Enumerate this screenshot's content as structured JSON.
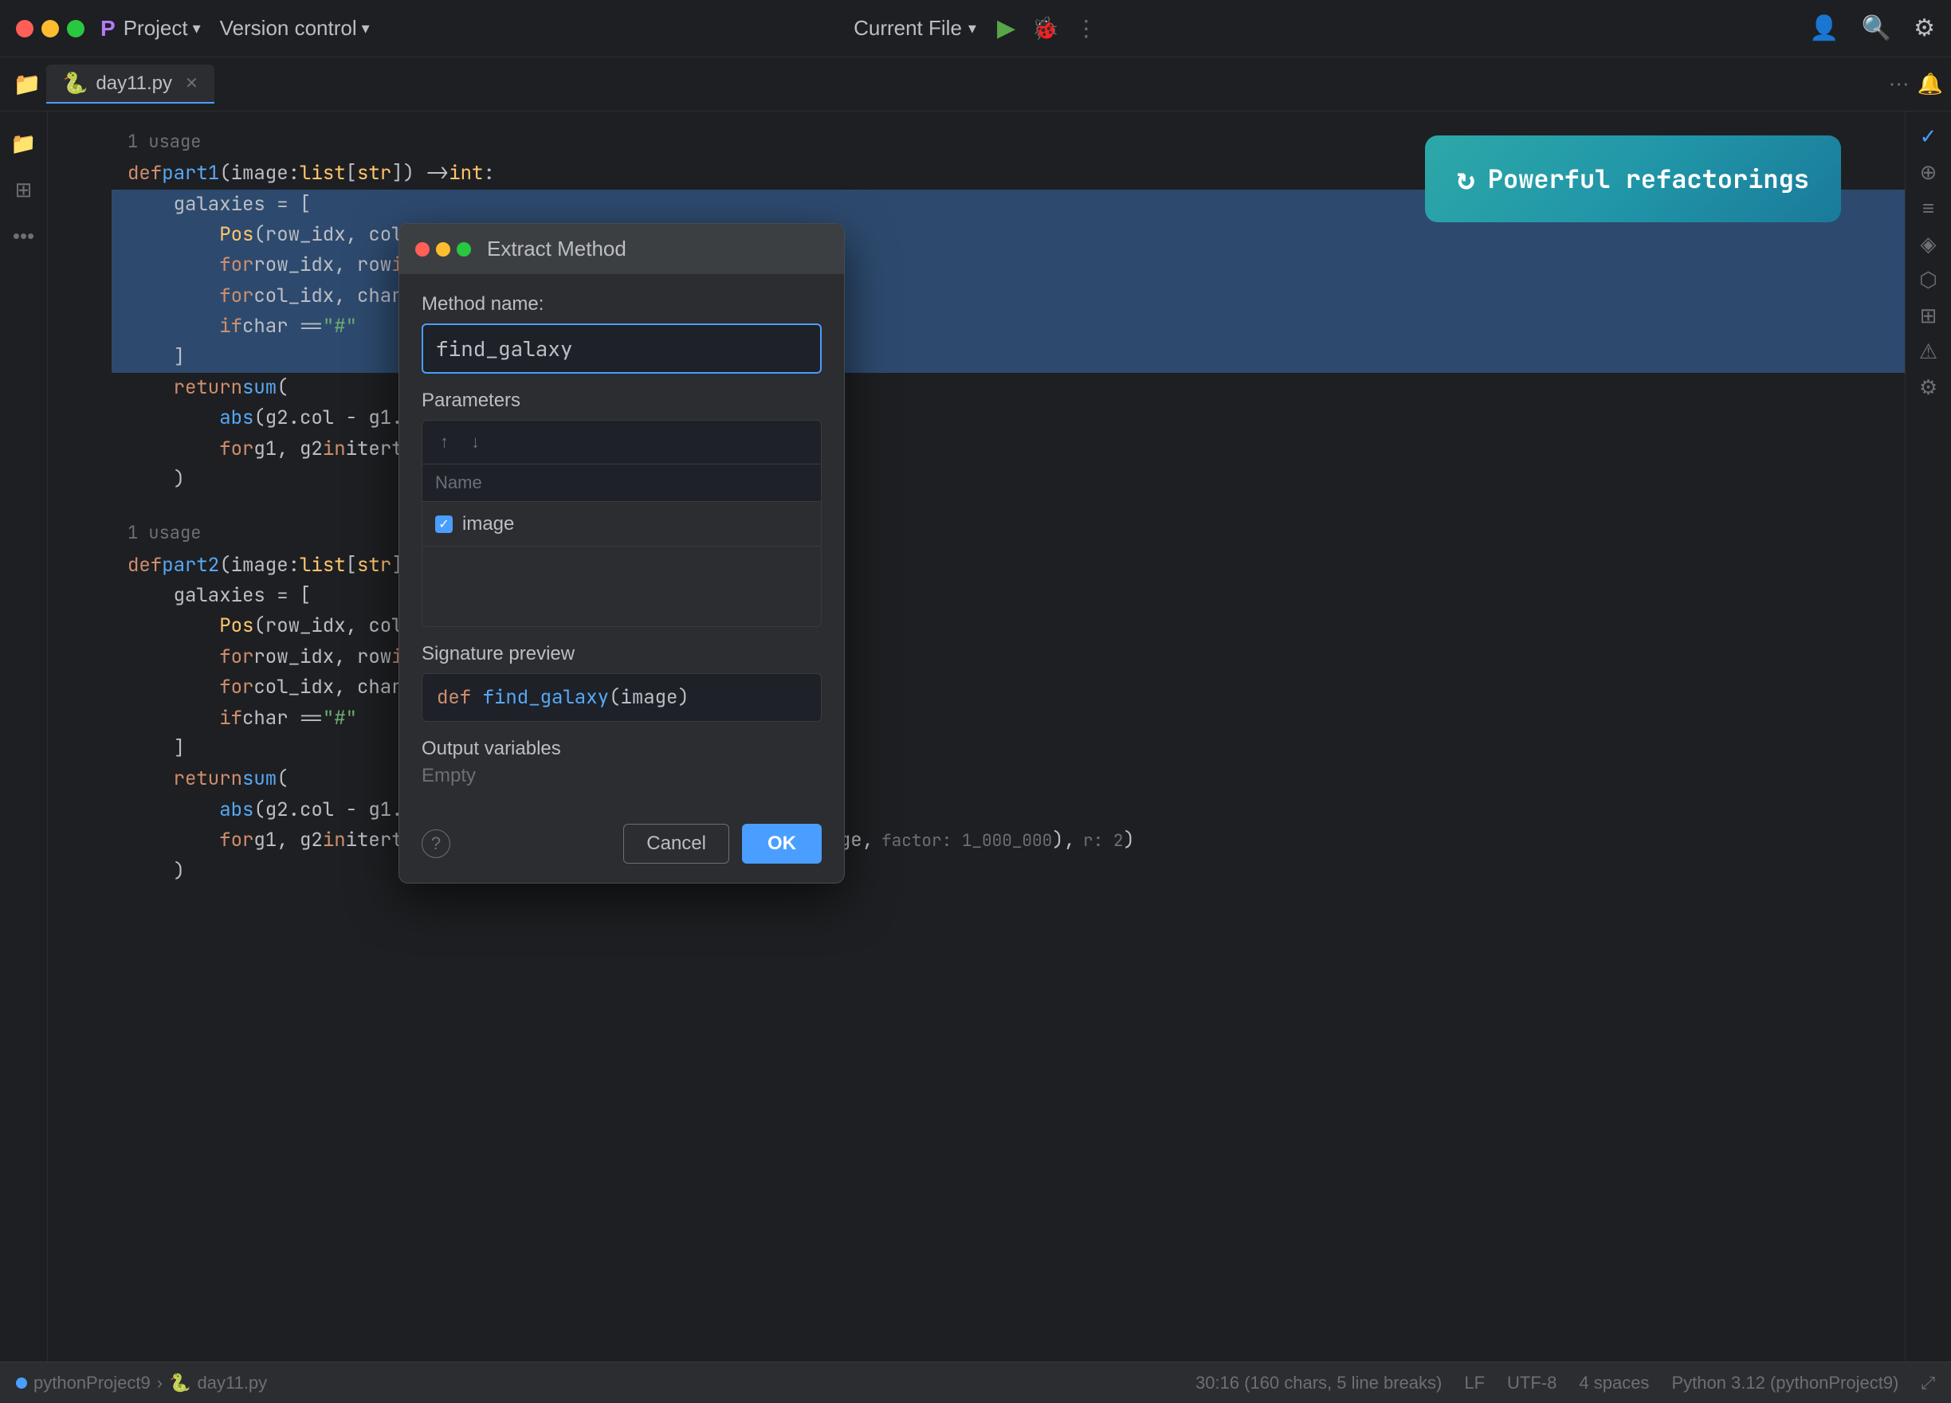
{
  "titlebar": {
    "app_name": "Project",
    "menu_item": "Version control",
    "current_file": "Current File",
    "traffic_lights": [
      "red",
      "yellow",
      "green"
    ]
  },
  "tabbar": {
    "tab_label": "day11.py",
    "tab_icon": "🐍",
    "more_icon": "⋯"
  },
  "refactor_banner": {
    "text": "Powerful refactorings",
    "icon": "↻"
  },
  "code": {
    "usage1": "1 usage",
    "line_def1": "def part1(image: list[str]) -> int:",
    "line_galaxies_open": "    galaxies = [",
    "line_pos": "        Pos(row_idx, col_idx)",
    "line_for_row": "        for row_idx, row in enumerate(ima",
    "line_for_col": "        for col_idx, char in enumerate(im",
    "line_if": "        if char == \"#\"",
    "line_bracket_close": "    ]",
    "line_return": "    return sum(",
    "line_abs1": "        abs(g2.col - g1.col) + abs(g2.ro",
    "line_for_g": "        for g1, g2 in itertools.combinati",
    "line_paren_close": "    )",
    "usage2": "1 usage",
    "line_def2": "def part2(image: list[str]) -> int:",
    "line_galaxies2_open": "    galaxies = [",
    "line_pos2": "        Pos(row_idx, col_idx)",
    "line_for_row2": "        for row_idx, row in enumerate(ima",
    "line_for_col2": "        for col_idx, char in enumerate(im",
    "line_if2": "        if char == \"#\"",
    "line_bracket2_close": "    ]",
    "line_return2": "    return sum(",
    "line_abs2": "        abs(g2.col - g1.col) + abs(g2.row - g1.row)",
    "line_for_g2": "        for g1, g2 in itertools.combinations(expand(galaxies, image,",
    "hint_factor": "factor: 1_000_000",
    "hint_r": "r: 2",
    "line_paren2_close": "    )"
  },
  "dialog": {
    "title": "Extract Method",
    "method_name_label": "Method name:",
    "method_name_value": "find_galaxy",
    "params_label": "Parameters",
    "params_up_icon": "↑",
    "params_down_icon": "↓",
    "name_column": "Name",
    "param_image": "image",
    "param_checked": true,
    "sig_label": "Signature preview",
    "sig_preview": "def find_galaxy(image)",
    "output_label": "Output variables",
    "output_value": "Empty",
    "help_icon": "?",
    "cancel_label": "Cancel",
    "ok_label": "OK"
  },
  "statusbar": {
    "project_icon": "○",
    "project_name": "pythonProject9",
    "arrow": "›",
    "file_name": "day11.py",
    "position": "30:16 (160 chars, 5 line breaks)",
    "line_ending": "LF",
    "encoding": "UTF-8",
    "indent": "4 spaces",
    "python_version": "Python 3.12 (pythonProject9)",
    "expand_icon": "⤢"
  },
  "sidebar_icons": [
    "☰",
    "◫",
    "•••"
  ],
  "right_icons": [
    "✓",
    "⊕",
    "≡",
    "◈",
    "⬡",
    "⊞",
    "⚠",
    "⚙"
  ]
}
